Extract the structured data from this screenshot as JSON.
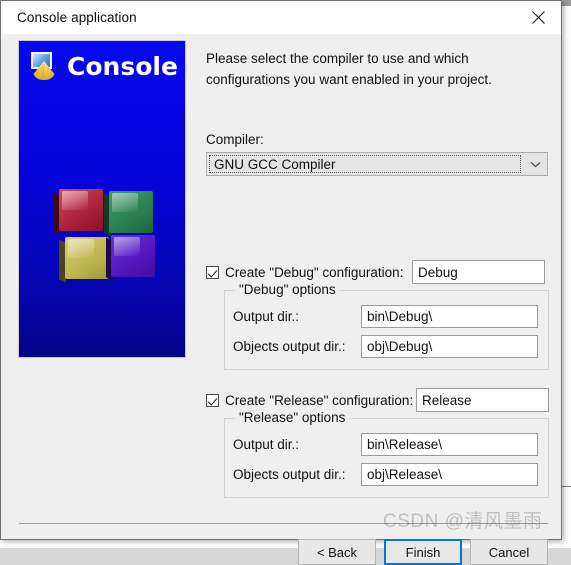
{
  "window": {
    "title": "Console application",
    "close_icon": "close-icon"
  },
  "banner": {
    "title": "Console",
    "app_icon": "console-app-icon",
    "logo": "codeblocks-cubes-logo",
    "cube_colors": [
      "#a8203c",
      "#2a7f50",
      "#bdb44f",
      "#5416bd"
    ],
    "background_color": "#0404d8"
  },
  "main": {
    "intro": "Please select the compiler to use and which configurations you want enabled in your project.",
    "compiler_label": "Compiler:",
    "compiler_value": "GNU GCC Compiler",
    "compiler_arrow_icon": "chevron-down-icon"
  },
  "debug": {
    "checkbox_label": "Create \"Debug\" configuration:",
    "checked": true,
    "name_value": "Debug",
    "group_legend": "\"Debug\" options",
    "output_dir_label": "Output dir.:",
    "output_dir_value": "bin\\Debug\\",
    "objects_dir_label": "Objects output dir.:",
    "objects_dir_value": "obj\\Debug\\"
  },
  "release": {
    "checkbox_label": "Create \"Release\" configuration:",
    "checked": true,
    "name_value": "Release",
    "group_legend": "\"Release\" options",
    "output_dir_label": "Output dir.:",
    "output_dir_value": "bin\\Release\\",
    "objects_dir_label": "Objects output dir.:",
    "objects_dir_value": "obj\\Release\\"
  },
  "footer": {
    "back_label": "< Back",
    "finish_label": "Finish",
    "cancel_label": "Cancel",
    "focused_button": "Finish",
    "focus_color": "#0078d7"
  },
  "watermark": {
    "text": "CSDN @清风墨雨"
  },
  "backdrop": {
    "links": [
      "ur",
      "t",
      "-1",
      "L.",
      "?-",
      "?-"
    ],
    "bar_colors": [
      "#8a7b1e",
      "#2b2c5e",
      "#3b3a6a",
      "#9b9b9b"
    ]
  }
}
